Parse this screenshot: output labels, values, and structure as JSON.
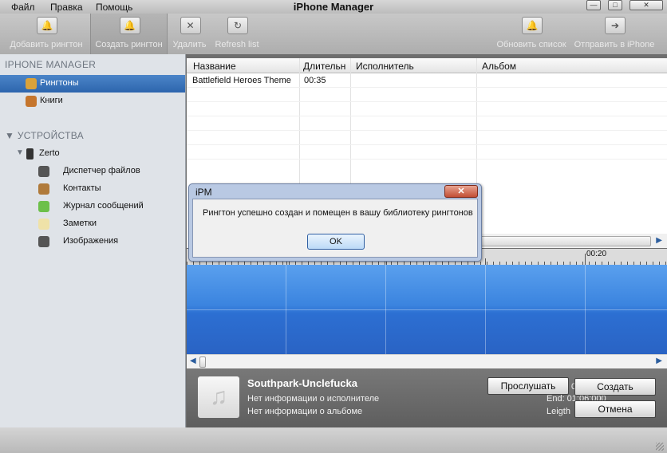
{
  "menu": [
    "Файл",
    "Правка",
    "Помощь"
  ],
  "app_title": "iPhone Manager",
  "window_buttons": {
    "minimize": "—",
    "maximize": "□",
    "close": "✕"
  },
  "toolbar": {
    "add": "Добавить рингтон",
    "create": "Создать рингтон",
    "delete": "Удалить",
    "refresh": "Refresh list",
    "update": "Обновить список",
    "send": "Отправить в iPhone"
  },
  "sidebar": {
    "header": "IPHONE MANAGER",
    "items": [
      {
        "label": "Рингтоны",
        "icon": "bell-icon",
        "selected": true
      },
      {
        "label": "Книги",
        "icon": "book-icon",
        "selected": false
      }
    ],
    "devices_header": "УСТРОЙСТВА",
    "device": {
      "label": "Zerto",
      "icon": "phone-icon"
    },
    "device_items": [
      {
        "label": "Диспетчер файлов",
        "icon": "apple-icon"
      },
      {
        "label": "Контакты",
        "icon": "contacts-icon"
      },
      {
        "label": "Журнал сообщений",
        "icon": "messages-icon"
      },
      {
        "label": "Заметки",
        "icon": "notes-icon"
      },
      {
        "label": "Изображения",
        "icon": "apple-icon"
      }
    ]
  },
  "table": {
    "columns": [
      "Название",
      "Длительн",
      "Исполнитель",
      "Альбом"
    ],
    "rows": [
      {
        "name": "Battlefield Heroes Theme",
        "duration": "00:35",
        "artist": "",
        "album": ""
      }
    ]
  },
  "ruler": {
    "label": "00:20"
  },
  "track": {
    "title": "Southpark-Unclefucka",
    "artist": "Нет информации о исполнителе",
    "album": "Нет информации о альбоме",
    "end_label": "End: 01:06:000",
    "length_label": "Leigth",
    "start_partial": "0"
  },
  "buttons": {
    "listen": "Прослушать",
    "create": "Создать",
    "cancel": "Отмена"
  },
  "dialog": {
    "title": "iPM",
    "close": "✕",
    "message": "Рингтон успешно создан и помещен в вашу библиотеку рингтонов",
    "ok": "OK"
  },
  "colors": {
    "selection": "#2d65ad",
    "wave": "#3b84df",
    "dialog_frame": "#b9c9e3"
  }
}
